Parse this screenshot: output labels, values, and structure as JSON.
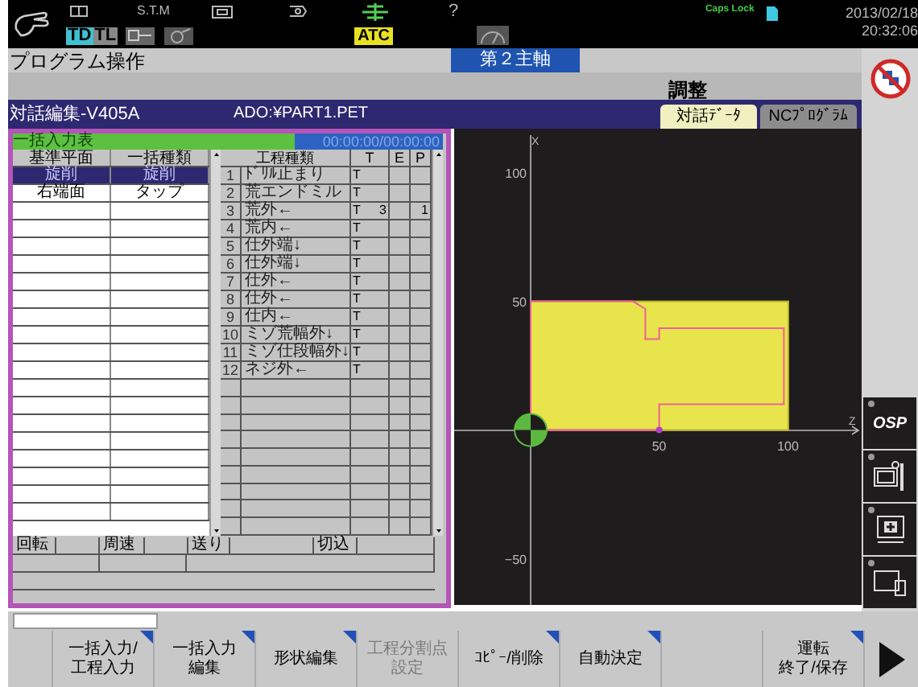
{
  "status_bar": {
    "stm": "S.T.M",
    "td": "TD",
    "tl": "TL",
    "atc": "ATC",
    "help": "?",
    "caps": [
      "Caps",
      "Lock"
    ],
    "date": "2013/02/18",
    "time": "20:32:06"
  },
  "title": "プログラム操作",
  "spindle": "第２主軸",
  "mode": "調整",
  "editor": {
    "title": "対話編集-V405A",
    "file": "ADO:¥PART1.PET"
  },
  "tabs": [
    {
      "label": "対話ﾃﾞｰﾀ",
      "selected": true
    },
    {
      "label": "NCﾌﾟﾛｸﾞﾗﾑ",
      "selected": false
    }
  ],
  "batch": {
    "title": "一括入力表",
    "time": "00:00:00/00:00:00",
    "columns": [
      "基準平面",
      "一括種類"
    ],
    "rows": [
      {
        "cells": [
          "旋削",
          "旋削"
        ],
        "selected": true
      },
      {
        "cells": [
          "右端面",
          "タップ"
        ],
        "selected": false
      }
    ]
  },
  "processes": {
    "columns": [
      "工程種類",
      "T",
      "E",
      "P"
    ],
    "rows": [
      {
        "no": "1",
        "name": "ﾄﾞﾘﾙ止まり",
        "t": "T"
      },
      {
        "no": "2",
        "name": "荒エンドミル",
        "t": "T"
      },
      {
        "no": "3",
        "name": "荒外←",
        "t": "T",
        "t_no": "3",
        "p": "1"
      },
      {
        "no": "4",
        "name": "荒内←",
        "t": "T"
      },
      {
        "no": "5",
        "name": "仕外端↓",
        "t": "T"
      },
      {
        "no": "6",
        "name": "仕外端↓",
        "t": "T"
      },
      {
        "no": "7",
        "name": "仕外←",
        "t": "T"
      },
      {
        "no": "8",
        "name": "仕外←",
        "t": "T"
      },
      {
        "no": "9",
        "name": "仕内←",
        "t": "T"
      },
      {
        "no": "10",
        "name": "ミゾ荒幅外↓",
        "t": "T"
      },
      {
        "no": "11",
        "name": "ミゾ仕段幅外↓",
        "t": "T"
      },
      {
        "no": "12",
        "name": "ネジ外←",
        "t": "T"
      }
    ]
  },
  "conditions": [
    "回転",
    "周速",
    "送り",
    "切込"
  ],
  "plot": {
    "x_axis": "Z",
    "y_axis": "X",
    "x_ticks": [
      "50",
      "100"
    ],
    "y_ticks": [
      "100",
      "50",
      "−50"
    ]
  },
  "side_buttons": [
    {
      "kind": "osp",
      "label": "OSP"
    },
    {
      "kind": "tools"
    },
    {
      "kind": "add"
    },
    {
      "kind": "windows"
    }
  ],
  "softkeys": [
    {
      "kind": "blank"
    },
    {
      "kind": "key",
      "lines": [
        "一括入力/",
        "工程入力"
      ],
      "marked": true,
      "disabled": false
    },
    {
      "kind": "key",
      "lines": [
        "一括入力",
        "編集"
      ],
      "marked": true,
      "disabled": false
    },
    {
      "kind": "key",
      "lines": [
        "形状編集"
      ],
      "marked": true,
      "disabled": false
    },
    {
      "kind": "key",
      "lines": [
        "工程分割点",
        "設定"
      ],
      "marked": false,
      "disabled": true
    },
    {
      "kind": "key",
      "lines": [
        "ｺﾋﾟｰ/削除"
      ],
      "marked": true,
      "disabled": false
    },
    {
      "kind": "key",
      "lines": [
        "自動決定"
      ],
      "marked": true,
      "disabled": false
    },
    {
      "kind": "blank"
    },
    {
      "kind": "key",
      "lines": [
        "運転",
        "終了/保存"
      ],
      "marked": true,
      "disabled": false
    },
    {
      "kind": "next"
    }
  ]
}
